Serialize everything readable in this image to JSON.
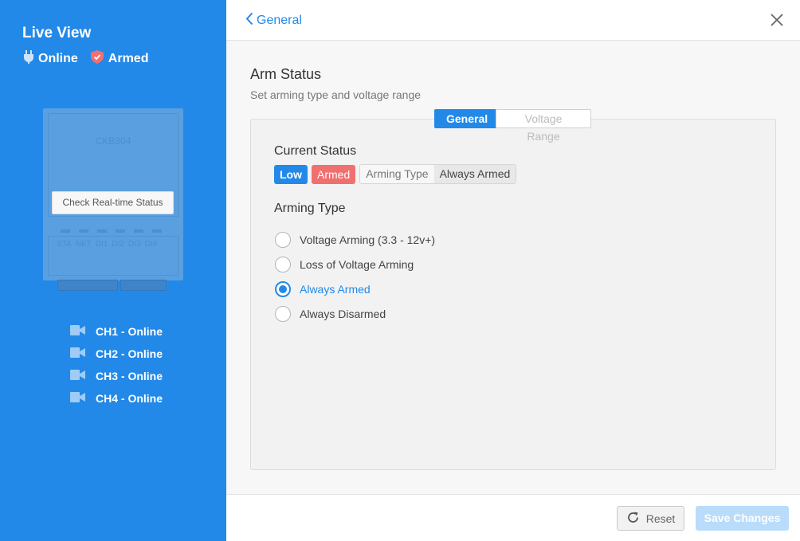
{
  "sidebar": {
    "title": "Live View",
    "status": [
      {
        "icon": "plug-icon",
        "label": "Online"
      },
      {
        "icon": "shield-icon",
        "label": "Armed"
      }
    ],
    "device": {
      "model": "CKB304",
      "check_button": "Check Real-time Status",
      "port_labels": [
        "STA",
        "NET",
        "DI1",
        "DI2",
        "DI3",
        "DI4"
      ]
    },
    "channels": [
      {
        "icon": "camera-icon",
        "label": "CH1 - Online"
      },
      {
        "icon": "camera-icon",
        "label": "CH2 - Online"
      },
      {
        "icon": "camera-icon",
        "label": "CH3 - Online"
      },
      {
        "icon": "camera-icon",
        "label": "CH4 - Online"
      }
    ]
  },
  "header": {
    "back_label": "General"
  },
  "section": {
    "title": "Arm Status",
    "subtitle": "Set arming type and voltage range"
  },
  "tabs": [
    {
      "label": "General",
      "active": true
    },
    {
      "label": "Voltage Range",
      "active": false
    }
  ],
  "current_status": {
    "title": "Current Status",
    "voltage_badge": "Low",
    "state_badge": "Armed",
    "type_key": "Arming Type",
    "type_value": "Always Armed"
  },
  "arming_type": {
    "title": "Arming Type",
    "options": [
      {
        "label": "Voltage Arming (3.3 - 12v+)",
        "checked": false
      },
      {
        "label": "Loss of Voltage Arming",
        "checked": false
      },
      {
        "label": "Always Armed",
        "checked": true
      },
      {
        "label": "Always Disarmed",
        "checked": false
      }
    ]
  },
  "footer": {
    "reset_label": "Reset",
    "save_label": "Save Changes"
  },
  "colors": {
    "accent": "#2389e8",
    "armed": "#f07070",
    "save_disabled": "#b9dcfb"
  }
}
